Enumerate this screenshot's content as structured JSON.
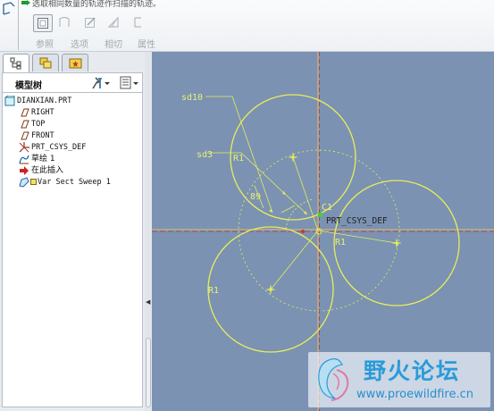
{
  "dashboard": {
    "message": "选取相同数量的轨迹作扫描的轨迹。",
    "buttons": [
      {
        "label": "参照",
        "icon": "reference-icon"
      },
      {
        "label": "选项",
        "icon": "options-icon"
      },
      {
        "label": "相切",
        "icon": "tangency-icon"
      },
      {
        "label": "属性",
        "icon": "properties-icon"
      }
    ]
  },
  "navigator": {
    "tabs": [
      "model-tree-tab",
      "layers-tab",
      "favorites-tab"
    ],
    "title": "模型树",
    "items": [
      {
        "label": "DIANXIAN.PRT",
        "icon": "part-icon"
      },
      {
        "label": "RIGHT",
        "icon": "datum-plane-icon"
      },
      {
        "label": "TOP",
        "icon": "datum-plane-icon"
      },
      {
        "label": "FRONT",
        "icon": "datum-plane-icon"
      },
      {
        "label": "PRT_CSYS_DEF",
        "icon": "csys-icon"
      },
      {
        "label": "草绘 1",
        "icon": "sketch-icon"
      },
      {
        "label": "在此插入",
        "icon": "insert-here-icon"
      },
      {
        "label": "Var Sect Sweep 1",
        "icon": "var-sect-sweep-icon"
      }
    ]
  },
  "graphics": {
    "dimensions": [
      "sd10",
      "sd3",
      "R1",
      "R1",
      "R1",
      "89",
      "C1"
    ],
    "csys_label": "PRT_CSYS_DEF",
    "colors": {
      "background": "#7b92b3",
      "sketch": "#e6ee5a",
      "axis": "#d8c070",
      "axis_red": "#c03030"
    }
  },
  "watermark": {
    "title": "野火论坛",
    "url": "www.proewildfire.cn"
  }
}
